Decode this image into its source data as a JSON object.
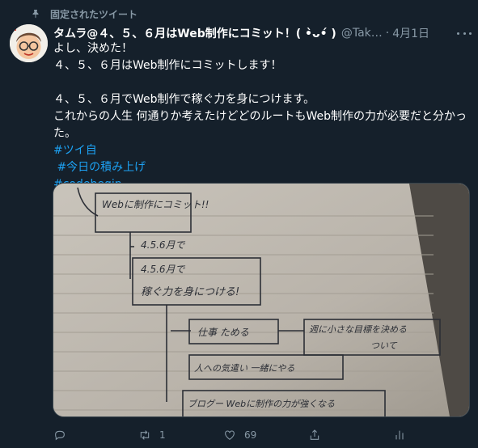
{
  "pinned": {
    "label": "固定されたツイート"
  },
  "tweet": {
    "author_name": "タムラ@４、５、６月はWeb制作にコミット！( •̀ᴗ•́ )",
    "handle": "@Tak…",
    "dot": "·",
    "date": "4月1日",
    "lines": [
      "よし、決めた！",
      "４、５、６月はWeb制作にコミットします！",
      "",
      "４、５、６月でWeb制作で稼ぐ力を身につけます。",
      "これからの人生 何通りか考えたけどどのルートもWeb制作の力が必要だと分かっ",
      "た。"
    ],
    "hashtags": [
      "#ツイ自",
      " #今日の積み上げ",
      "#codebegin"
    ],
    "photo_notes": [
      "Webに制作にコミット!!",
      "4.5.6月で",
      "4.5.6月で",
      "稼ぐ力を身につける!",
      "仕事 ためる",
      "週に小さな目標を決める",
      "ついて",
      "人への気遣い 一緒にやる",
      "ブログー Webに制作の力が強くなる"
    ]
  },
  "actions": {
    "reply": {
      "icon": "reply-icon",
      "count": ""
    },
    "retweet": {
      "icon": "retweet-icon",
      "count": "1"
    },
    "like": {
      "icon": "heart-icon",
      "count": "69"
    },
    "share": {
      "icon": "share-icon",
      "count": ""
    },
    "analytics": {
      "icon": "analytics-icon",
      "count": ""
    }
  },
  "colors": {
    "background": "#15202b",
    "text": "#ffffff",
    "muted": "#8899a6",
    "link": "#1da1f2"
  }
}
